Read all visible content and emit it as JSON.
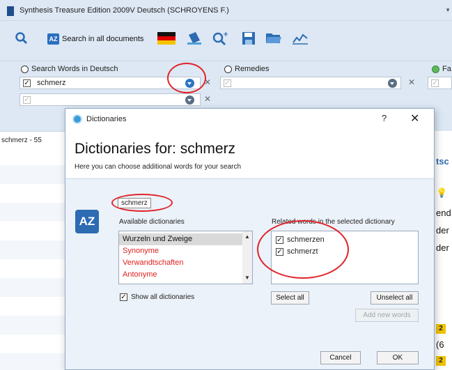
{
  "app": {
    "title": "Synthesis Treasure Edition 2009V Deutsch (SCHROYENS F.)",
    "toolbar": {
      "search_all_label": "Search in all documents",
      "az_icon_text": "AZ"
    },
    "columns": {
      "search_words_header": "Search Words in Deutsch",
      "remedies_header": "Remedies",
      "third_header": "Fa"
    },
    "search_word_value": "schmerz",
    "results_header": "schmerz - 55",
    "right_peek": {
      "line1": "tsc",
      "line2": "end",
      "line3": "der",
      "line4": "der",
      "badge1": "2",
      "paren": "(6",
      "badge2": "2"
    }
  },
  "dialog": {
    "window_title": "Dictionaries",
    "help_label": "?",
    "close_label": "✕",
    "heading": "Dictionaries for: schmerz",
    "subheading": "Here you can choose additional words for your search",
    "word_chip": "schmerz",
    "az_icon_text": "AZ",
    "available_label": "Available dictionaries",
    "related_label": "Related words in the selected dictionary",
    "dictionaries": [
      {
        "label": "Wurzeln und Zweige",
        "selected": true,
        "color": "#111111"
      },
      {
        "label": "Synonyme",
        "selected": false,
        "color": "#e02020"
      },
      {
        "label": "Verwandtschaften",
        "selected": false,
        "color": "#e02020"
      },
      {
        "label": "Antonyme",
        "selected": false,
        "color": "#e02020"
      }
    ],
    "related_words": [
      {
        "label": "schmerzen",
        "checked": true
      },
      {
        "label": "schmerzt",
        "checked": true
      }
    ],
    "show_all_label": "Show all dictionaries",
    "show_all_checked": true,
    "select_all_label": "Select all",
    "unselect_all_label": "Unselect all",
    "add_new_words_label": "Add new words",
    "cancel_label": "Cancel",
    "ok_label": "OK"
  },
  "colors": {
    "chrome": "#dde8f4",
    "accent_blue": "#2d6bb3",
    "annotation_red": "#e0242a",
    "dictionary_red": "#e02020"
  }
}
